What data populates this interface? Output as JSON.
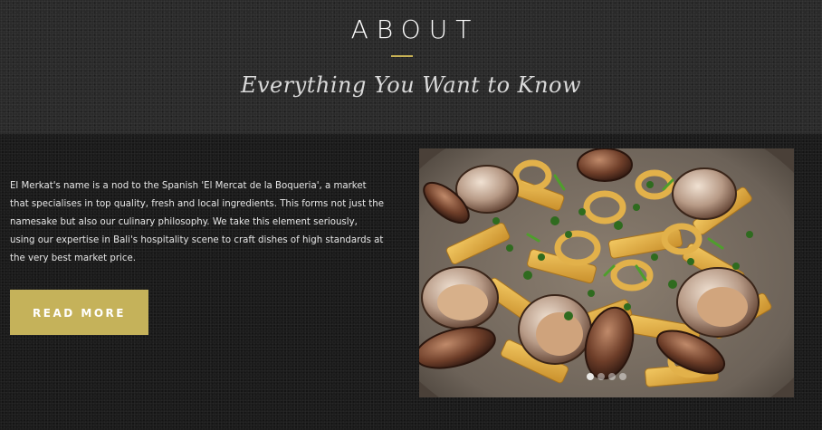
{
  "header": {
    "title": "ABOUT",
    "subtitle": "Everything You Want to Know"
  },
  "about": {
    "body_lines": [
      "El Merkat's name is a nod to the Spanish 'El Mercat de la Boqueria', a market",
      "that specialises in top quality, fresh and local ingredients. This forms not just the",
      "namesake but also our culinary philosophy. We take this element seriously,",
      "using our expertise in Bali's hospitality scene to craft dishes of high standards at",
      "the very best market price."
    ],
    "read_more_label": "READ MORE"
  },
  "gallery": {
    "slide_count": 4,
    "active_index": 0
  },
  "colors": {
    "accent": "#c5b25a",
    "divider": "#c8b255",
    "background": "#1b1b1b"
  }
}
